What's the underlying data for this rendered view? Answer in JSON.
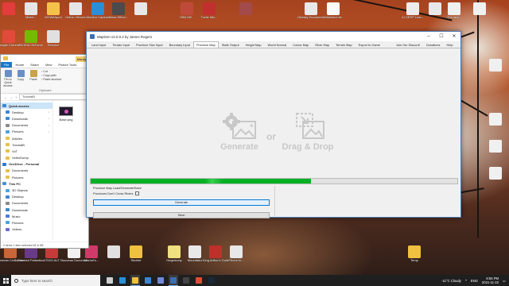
{
  "desktop": {
    "icons_row1": [
      {
        "label": "",
        "color": "#e33c3c"
      },
      {
        "label": "Mister...",
        "color": "#e5e5e5"
      },
      {
        "label": "MCWeApo4",
        "color": "#f4c24a"
      },
      {
        "label": "Helion Heroes",
        "color": "#e6e6e6"
      },
      {
        "label": "Monitor Capture",
        "color": "#2a8fd6"
      },
      {
        "label": "Mass Effect...",
        "color": "#4b4b4b"
      },
      {
        "label": "",
        "color": "#e8e8e8"
      },
      {
        "label": "7854782...",
        "color": "#c04a3a"
      },
      {
        "label": "Turtle Mix...",
        "color": "#c22f2f"
      },
      {
        "label": "",
        "color": "#a34a4a"
      },
      {
        "label": "Obesity Documents...",
        "color": "#e8e8e8"
      },
      {
        "label": "Malinbox.txt",
        "color": "#fafafa"
      },
      {
        "label": "AI DEEP Lear...",
        "color": "#ececec"
      },
      {
        "label": "",
        "color": "#e8e8e8"
      },
      {
        "label": "The lazy...",
        "color": "#f0f0f0"
      },
      {
        "label": "",
        "color": "#f0f0f0"
      }
    ],
    "icons_row2": [
      {
        "label": "Google Chrome",
        "color": "#e24a3a"
      },
      {
        "label": "NVIDIA GeForce",
        "color": "#76b900"
      },
      {
        "label": "Resolve",
        "color": "#e0e0e0"
      }
    ],
    "icons_bottom": [
      {
        "label": "Mexican Civilization",
        "color": "#c8663a"
      },
      {
        "label": "Cracked Pallanticore",
        "color": "#6a3a8a"
      },
      {
        "label": "CSGO ALT",
        "color": "#c83a3a"
      },
      {
        "label": "Nouveau Document",
        "color": "#f0f0f0"
      },
      {
        "label": "Marvel's... ",
        "color": "#d03a6a"
      },
      {
        "label": "",
        "color": "#e0e0e0"
      },
      {
        "label": "Sticklet",
        "color": "#f0c040"
      },
      {
        "label": "Hegemony",
        "color": "#f0e080"
      },
      {
        "label": "Mountainz",
        "color": "#e8e8e8"
      },
      {
        "label": "King Arthur's Gold",
        "color": "#c0302a"
      },
      {
        "label": "Phone In...",
        "color": "#e8e8e8"
      },
      {
        "label": "Temp",
        "color": "#f0c040"
      }
    ],
    "icons_right": [
      {
        "label": "",
        "color": "#f0f0f0"
      },
      {
        "label": "",
        "color": "#f0f0f0"
      },
      {
        "label": "",
        "color": "#f0f0f0"
      },
      {
        "label": "",
        "color": "#f0f0f0"
      }
    ]
  },
  "explorer": {
    "manage_tab": "Manage",
    "tabs": [
      "File",
      "Home",
      "Share",
      "View",
      "Picture Tools"
    ],
    "ribbon": {
      "pin": "Pin to Quick access",
      "copy": "Copy",
      "paste": "Paste",
      "list": [
        "Cut",
        "Copy path",
        "Paste shortcut"
      ],
      "group": "Clipboard"
    },
    "path": "TutorialB",
    "nav": [
      {
        "label": "Quick access",
        "top": true,
        "color": "#3a86d4",
        "pin": false
      },
      {
        "label": "Desktop",
        "top": false,
        "color": "#3a86d4",
        "pin": true
      },
      {
        "label": "Downloads",
        "top": false,
        "color": "#3a86d4",
        "pin": true
      },
      {
        "label": "Documents",
        "top": false,
        "color": "#8a8a8a",
        "pin": true
      },
      {
        "label": "Pictures",
        "top": false,
        "color": "#4aa3df",
        "pin": true
      },
      {
        "label": "Articles",
        "top": false,
        "color": "#e8c04a",
        "pin": false
      },
      {
        "label": "TutorialB",
        "top": false,
        "color": "#e8c04a",
        "pin": false
      },
      {
        "label": "VoT",
        "top": false,
        "color": "#e8c04a",
        "pin": false
      },
      {
        "label": "VideoDump",
        "top": false,
        "color": "#e8c04a",
        "pin": false
      },
      {
        "label": "OneDrive - Personal",
        "top": true,
        "color": "#2a7ad4",
        "pin": false
      },
      {
        "label": "Documents",
        "top": false,
        "color": "#e8c04a",
        "pin": false
      },
      {
        "label": "Pictures",
        "top": false,
        "color": "#e8c04a",
        "pin": false
      },
      {
        "label": "This PC",
        "top": true,
        "color": "#4a90d0",
        "pin": false
      },
      {
        "label": "3D Objects",
        "top": false,
        "color": "#4aa3df",
        "pin": false
      },
      {
        "label": "Desktop",
        "top": false,
        "color": "#3a86d4",
        "pin": false
      },
      {
        "label": "Documents",
        "top": false,
        "color": "#8a8a8a",
        "pin": false
      },
      {
        "label": "Downloads",
        "top": false,
        "color": "#3a86d4",
        "pin": false
      },
      {
        "label": "Music",
        "top": false,
        "color": "#4a7ad4",
        "pin": false
      },
      {
        "label": "Pictures",
        "top": false,
        "color": "#4aa3df",
        "pin": false
      },
      {
        "label": "Videos",
        "top": false,
        "color": "#6a6ad4",
        "pin": false
      }
    ],
    "file_name": "Base.png",
    "status": "2 items    1 item selected  61.6 KB"
  },
  "mapgen": {
    "title": "MapGen v2.0.0.2 by James Rogers",
    "tabs_left": [
      "Land Input",
      "Terrain Input",
      "Province Size Input",
      "Boundary Input",
      "Province Map",
      "State Output",
      "Height Map",
      "World Normal",
      "Colour Map",
      "River Map",
      "Terrain Map",
      "Export to Game"
    ],
    "active_tab": "Province Map",
    "tabs_right": [
      "Join Our Discord!",
      "Donations",
      "Help"
    ],
    "generate_label": "Generate",
    "or_label": "or",
    "drag_label": "Drag & Drop",
    "progress": 0.6,
    "status_line": "Province Map Load/Generate/Save",
    "checkbox_label": "Provinces Don't Cross Rivers",
    "checkbox_checked": false,
    "generate_button": "Generate",
    "save_button": "Save"
  },
  "taskbar": {
    "search_placeholder": "Type here to search",
    "apps": [
      {
        "name": "task-view",
        "color": "#cfcfcf",
        "active": false
      },
      {
        "name": "edge",
        "color": "#2a8fd6",
        "active": false
      },
      {
        "name": "file-explorer",
        "color": "#f0c040",
        "active": true
      },
      {
        "name": "store",
        "color": "#3a86d4",
        "active": false
      },
      {
        "name": "discord",
        "color": "#7289da",
        "active": false
      },
      {
        "name": "mapgen",
        "color": "#3a6fb5",
        "active": true
      },
      {
        "name": "terminal",
        "color": "#444",
        "active": false
      },
      {
        "name": "chrome",
        "color": "#e24a3a",
        "active": false
      },
      {
        "name": "steam",
        "color": "#1b2838",
        "active": false
      }
    ],
    "weather": "-11°C Cloudy",
    "lang": "ENG",
    "time": "8:55 PM",
    "date": "2021-11-22"
  }
}
